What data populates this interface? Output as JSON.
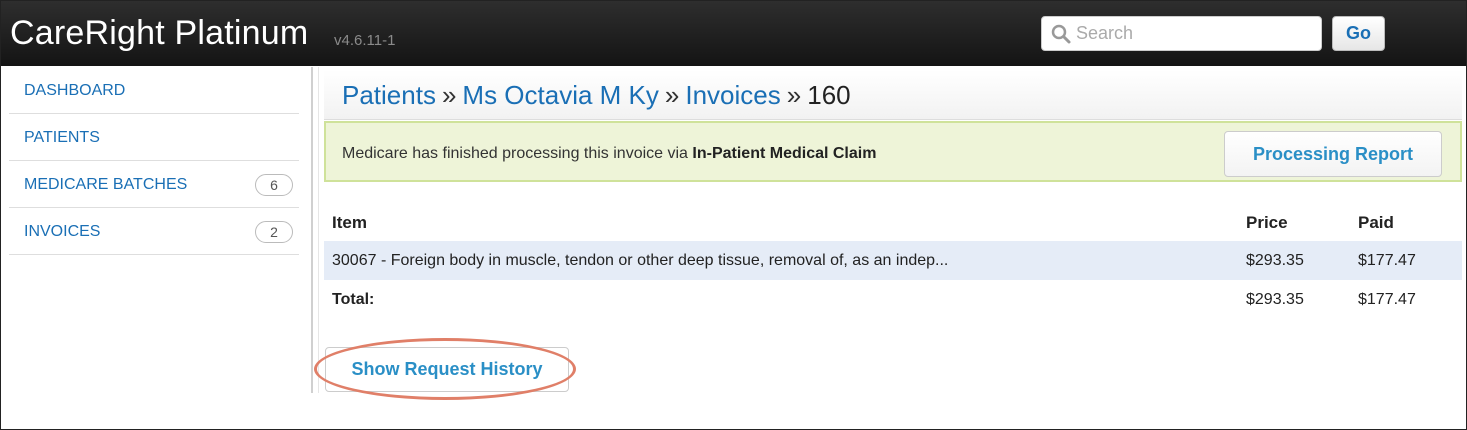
{
  "app": {
    "title": "CareRight Platinum",
    "version": "v4.6.11-1"
  },
  "search": {
    "placeholder": "Search",
    "go_label": "Go"
  },
  "sidebar": {
    "items": [
      {
        "label": "DASHBOARD",
        "badge": ""
      },
      {
        "label": "PATIENTS",
        "badge": ""
      },
      {
        "label": "MEDICARE BATCHES",
        "badge": "6"
      },
      {
        "label": "INVOICES",
        "badge": "2"
      }
    ]
  },
  "breadcrumb": {
    "patients": "Patients",
    "patient_name": "Ms Octavia M Ky",
    "invoices": "Invoices",
    "separator": "»",
    "current": "160"
  },
  "alert": {
    "text": "Medicare has finished processing this invoice via ",
    "method": "In-Patient Medical Claim",
    "button_label": "Processing Report"
  },
  "table": {
    "headers": {
      "item": "Item",
      "price": "Price",
      "paid": "Paid"
    },
    "rows": [
      {
        "item": "30067 - Foreign body in muscle, tendon or other deep tissue, removal of, as an indep...",
        "price": "$293.35",
        "paid": "$177.47"
      }
    ],
    "total": {
      "label": "Total:",
      "price": "$293.35",
      "paid": "$177.47"
    }
  },
  "actions": {
    "history_label": "Show Request History"
  },
  "colors": {
    "link": "#1a6fb5",
    "button_text": "#2a8fc6",
    "alert_bg": "#eef4d8",
    "highlight_ring": "#e07f68",
    "row_highlight": "#e5ecf7"
  }
}
